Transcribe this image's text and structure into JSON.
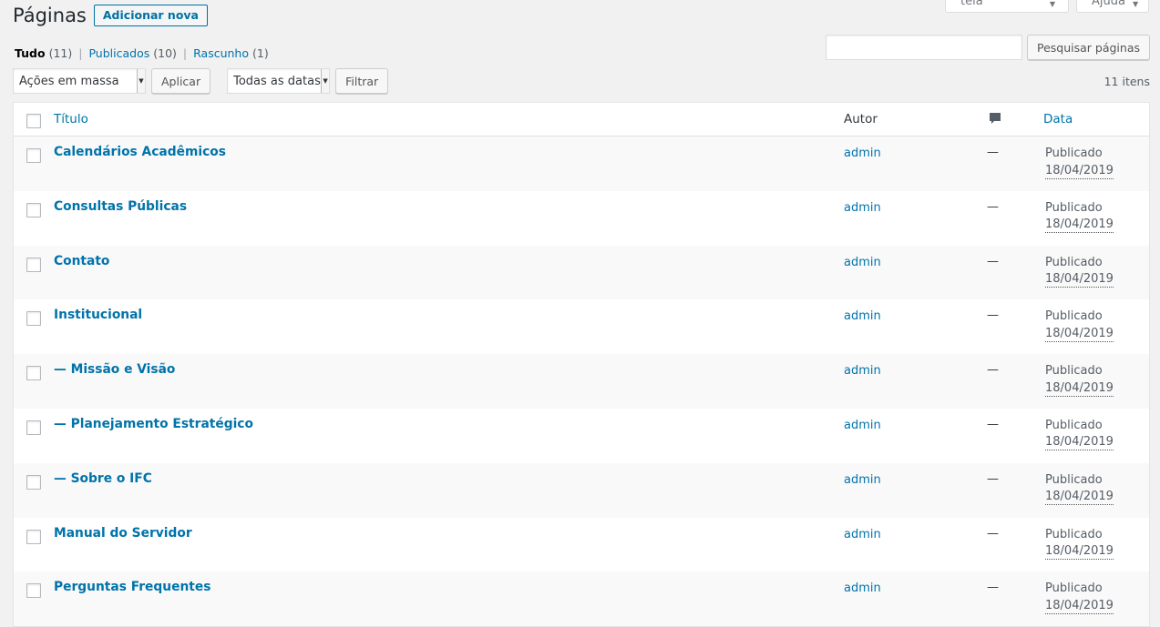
{
  "screen_meta": {
    "screen_options_label": "Opções de tela",
    "help_label": "Ajuda"
  },
  "header": {
    "title": "Páginas",
    "add_new_label": "Adicionar nova"
  },
  "views": {
    "all_label": "Tudo",
    "all_count": "(11)",
    "published_label": "Publicados",
    "published_count": "(10)",
    "draft_label": "Rascunho",
    "draft_count": "(1)",
    "separator": "|"
  },
  "search": {
    "button_label": "Pesquisar páginas",
    "value": ""
  },
  "tablenav": {
    "bulk_actions": "Ações em massa",
    "apply_label": "Aplicar",
    "date_filter": "Todas as datas",
    "filter_label": "Filtrar",
    "items_count": "11 itens"
  },
  "table": {
    "headers": {
      "title": "Título",
      "author": "Autor",
      "date": "Data"
    },
    "rows": [
      {
        "title": "Calendários Acadêmicos",
        "author": "admin",
        "comments": "—",
        "status": "Publicado",
        "date": "18/04/2019"
      },
      {
        "title": "Consultas Públicas",
        "author": "admin",
        "comments": "—",
        "status": "Publicado",
        "date": "18/04/2019"
      },
      {
        "title": "Contato",
        "author": "admin",
        "comments": "—",
        "status": "Publicado",
        "date": "18/04/2019"
      },
      {
        "title": "Institucional",
        "author": "admin",
        "comments": "—",
        "status": "Publicado",
        "date": "18/04/2019"
      },
      {
        "title": "— Missão e Visão",
        "author": "admin",
        "comments": "—",
        "status": "Publicado",
        "date": "18/04/2019"
      },
      {
        "title": "— Planejamento Estratégico",
        "author": "admin",
        "comments": "—",
        "status": "Publicado",
        "date": "18/04/2019"
      },
      {
        "title": "— Sobre o IFC",
        "author": "admin",
        "comments": "—",
        "status": "Publicado",
        "date": "18/04/2019"
      },
      {
        "title": "Manual do Servidor",
        "author": "admin",
        "comments": "—",
        "status": "Publicado",
        "date": "18/04/2019"
      },
      {
        "title": "Perguntas Frequentes",
        "author": "admin",
        "comments": "—",
        "status": "Publicado",
        "date": "18/04/2019"
      }
    ]
  },
  "colors": {
    "link": "#0073aa",
    "background": "#f1f1f1",
    "row_alt": "#f9f9f9"
  }
}
